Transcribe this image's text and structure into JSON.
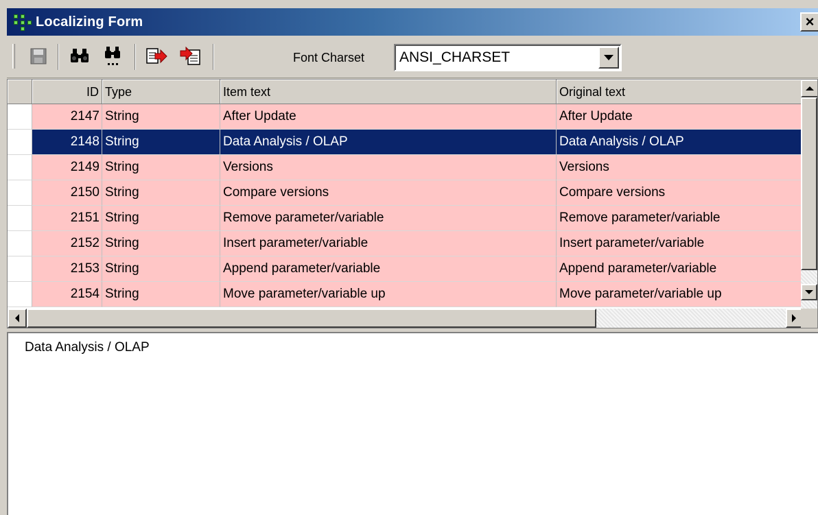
{
  "window": {
    "title": "Localizing Form",
    "close_label": "×"
  },
  "toolbar": {
    "buttons": [
      {
        "name": "save-button",
        "icon": "floppy-disk-icon"
      },
      {
        "name": "find-button",
        "icon": "binoculars-icon"
      },
      {
        "name": "find-next-button",
        "icon": "binoculars-dots-icon"
      },
      {
        "name": "export-button",
        "icon": "export-arrow-icon"
      },
      {
        "name": "import-button",
        "icon": "import-arrow-icon"
      }
    ],
    "charset_label": "Font Charset",
    "charset_value": "ANSI_CHARSET"
  },
  "grid": {
    "columns": [
      "ID",
      "Type",
      "Item text",
      "Original text"
    ],
    "rows": [
      {
        "id": "2147",
        "type": "String",
        "item": "After Update",
        "original": "After Update"
      },
      {
        "id": "2148",
        "type": "String",
        "item": "Data Analysis / OLAP",
        "original": "Data Analysis / OLAP",
        "selected": true
      },
      {
        "id": "2149",
        "type": "String",
        "item": "Versions",
        "original": "Versions"
      },
      {
        "id": "2150",
        "type": "String",
        "item": "Compare versions",
        "original": "Compare versions"
      },
      {
        "id": "2151",
        "type": "String",
        "item": "Remove parameter/variable",
        "original": "Remove parameter/variable"
      },
      {
        "id": "2152",
        "type": "String",
        "item": "Insert parameter/variable",
        "original": "Insert parameter/variable"
      },
      {
        "id": "2153",
        "type": "String",
        "item": "Append parameter/variable",
        "original": "Append parameter/variable"
      },
      {
        "id": "2154",
        "type": "String",
        "item": "Move parameter/variable up",
        "original": "Move parameter/variable up"
      }
    ],
    "colors": {
      "row_bg": "#ffc6c6",
      "selected_bg": "#0a246a",
      "selected_fg": "#ffffff"
    }
  },
  "memo": {
    "text": "Data Analysis / OLAP"
  }
}
